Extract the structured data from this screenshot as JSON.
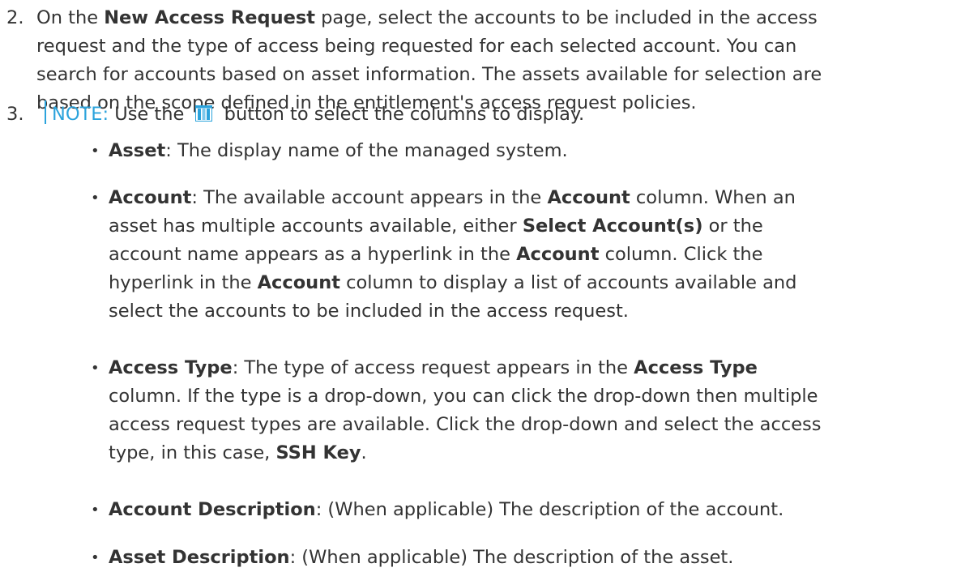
{
  "step2": {
    "number": "2.",
    "lines": [
      [
        "On the ",
        {
          "b": "New Access Request"
        },
        " page, select the accounts to be included in the access"
      ],
      [
        "request and the type of access being requested for each selected account. You can"
      ],
      [
        "search for accounts based on asset information. The assets available for selection are"
      ],
      [
        "based on the scope defined in the entitlement's access request policies."
      ]
    ]
  },
  "step3": {
    "number": "3.",
    "note_label": "NOTE:",
    "note_before": " Use the ",
    "note_icon": "columns-icon",
    "note_after": " button to select the columns to display.",
    "accent_color": "#2ba3dc"
  },
  "bullets": [
    {
      "lines": [
        [
          {
            "b": "Asset"
          },
          ": The display name of the managed system."
        ]
      ]
    },
    {
      "lines": [
        [
          {
            "b": "Account"
          },
          ": The available account appears in the ",
          {
            "b": "Account"
          },
          " column. When an"
        ],
        [
          "asset has multiple accounts available, either ",
          {
            "b": "Select Account(s)"
          },
          " or the"
        ],
        [
          "account name appears as a hyperlink in the ",
          {
            "b": "Account"
          },
          " column. Click the"
        ],
        [
          "hyperlink in the ",
          {
            "b": "Account"
          },
          " column to display a list of accounts available and"
        ],
        [
          "select the accounts to be included in the access request."
        ]
      ]
    },
    {
      "lines": [
        [
          {
            "b": "Access Type"
          },
          ": The type of access request appears in the ",
          {
            "b": "Access Type"
          }
        ],
        [
          "column. If the type is a drop-down, you can click the drop-down then multiple"
        ],
        [
          "access request types are available. Click the drop-down and select the access"
        ],
        [
          "type, in this case, ",
          {
            "b": "SSH Key"
          },
          "."
        ]
      ]
    },
    {
      "lines": [
        [
          {
            "b": "Account Description"
          },
          ": (When applicable) The description of the account."
        ]
      ]
    },
    {
      "lines": [
        [
          {
            "b": "Asset Description"
          },
          ": (When applicable) The description of the asset."
        ]
      ]
    }
  ]
}
